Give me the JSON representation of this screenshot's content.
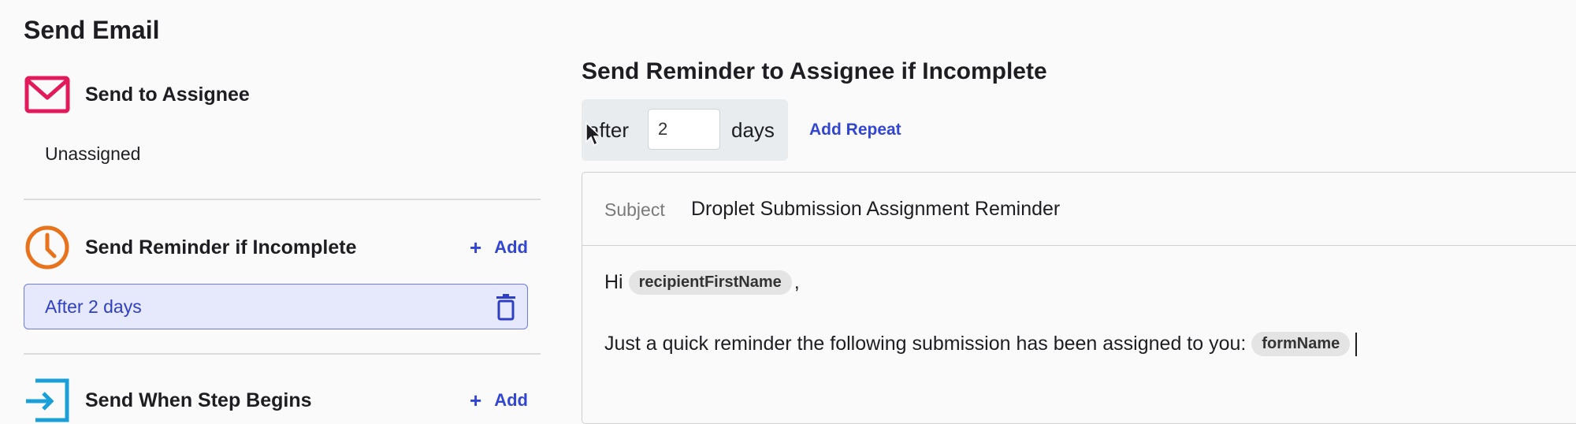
{
  "page_title": "Send Email",
  "left": {
    "send_to_assignee": {
      "label": "Send to Assignee",
      "value": "Unassigned",
      "icon": "mail-icon",
      "color": "#e2195b"
    },
    "send_reminder": {
      "label": "Send Reminder if Incomplete",
      "add_label": "Add",
      "icon": "clock-icon",
      "color": "#e8731c",
      "reminders": [
        "After 2 days"
      ]
    },
    "send_when_step_begins": {
      "label": "Send When Step Begins",
      "add_label": "Add",
      "icon": "enter-icon",
      "color": "#1aa0d8"
    }
  },
  "reminder_panel": {
    "title": "Send Reminder to Assignee if Incomplete",
    "after_label": "after",
    "days_value": "2",
    "days_label": "days",
    "add_repeat_label": "Add Repeat",
    "subject_label": "Subject",
    "subject_value": "Droplet Submission Assignment Reminder",
    "body": {
      "greeting": "Hi",
      "greeting_token": "recipientFirstName",
      "greeting_suffix": ",",
      "line2_text": "Just a quick reminder the following submission has been assigned to you:",
      "line2_token": "formName"
    }
  },
  "colors": {
    "accent": "#3346d3",
    "chip_bg": "#e6e9fb"
  }
}
